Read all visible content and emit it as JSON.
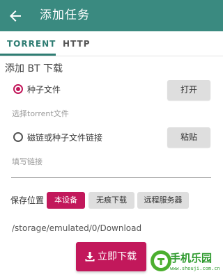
{
  "appbar": {
    "title": "添加任务",
    "back_icon": "arrow-left-icon",
    "background": "#3a8a80"
  },
  "tabs": [
    {
      "label": "TORRENT",
      "selected": true
    },
    {
      "label": "HTTP",
      "selected": false
    }
  ],
  "section_title": "添加 BT 下载",
  "torrent_option": {
    "label": "种子文件",
    "selected": true,
    "button": "打开",
    "hint": "选择torrent文件"
  },
  "magnet_option": {
    "label": "磁链或种子文件链接",
    "selected": false,
    "button": "粘贴",
    "placeholder": "填写链接"
  },
  "save": {
    "label": "保存位置",
    "options": [
      {
        "label": "本设备",
        "selected": true
      },
      {
        "label": "无痕下载",
        "selected": false
      },
      {
        "label": "远程服务器",
        "selected": false
      }
    ],
    "path": "/storage/emulated/0/Download"
  },
  "download_button": {
    "label": "立即下载",
    "icon": "download-icon"
  },
  "watermark": {
    "text": "手机乐园",
    "sub": "www.shouji.com.cn"
  },
  "colors": {
    "accent": "#c2185b",
    "primary": "#3a8a80"
  }
}
